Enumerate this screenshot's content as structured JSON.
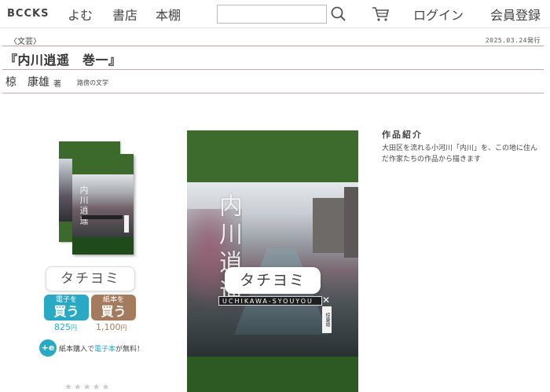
{
  "header": {
    "logo": "BCCKS",
    "nav": {
      "yomu": "よむ",
      "shoten": "書店",
      "hondana": "本棚",
      "login": "ログイン",
      "register": "会員登録"
    },
    "search": {
      "value": "",
      "placeholder": ""
    },
    "icons": {
      "search": "search-icon",
      "cart": "cart-icon"
    }
  },
  "book": {
    "category": "〈文芸〉",
    "pubdate": "2025.03.24発行",
    "title": "『内川逍遥　巻一』",
    "author": "椋　康雄",
    "author_role": "著",
    "label": "路傍の文学"
  },
  "purchase": {
    "tachiyomi": "タチヨミ",
    "ebook": {
      "kind": "電子を",
      "verb": "買う",
      "price": "825",
      "unit": "円"
    },
    "paper": {
      "kind": "紙本を",
      "verb": "買う",
      "price": "1,100",
      "unit": "円"
    },
    "promo": {
      "icon_text": "+e",
      "before": "紙本購入で",
      "highlight": "電子本",
      "after": "が無料！"
    },
    "stars": "★★★★★"
  },
  "cover": {
    "title": "内川逍遥",
    "small_title": "内川逍遥",
    "romaji": "UCHIKAWA-SYOUYOU",
    "mark": "✕",
    "author_tag": "椋康雄",
    "tachiyomi": "タチヨミ"
  },
  "description": {
    "heading": "作品紹介",
    "body": "大田区を流れる小河川「内川」を、この地に住んだ作家たちの作品から描きます"
  },
  "colors": {
    "accent_ebook": "#2aa9c4",
    "accent_paper": "#a57b5d",
    "cover_green": "#3a6a2a",
    "rule": "#c6a6aa"
  }
}
